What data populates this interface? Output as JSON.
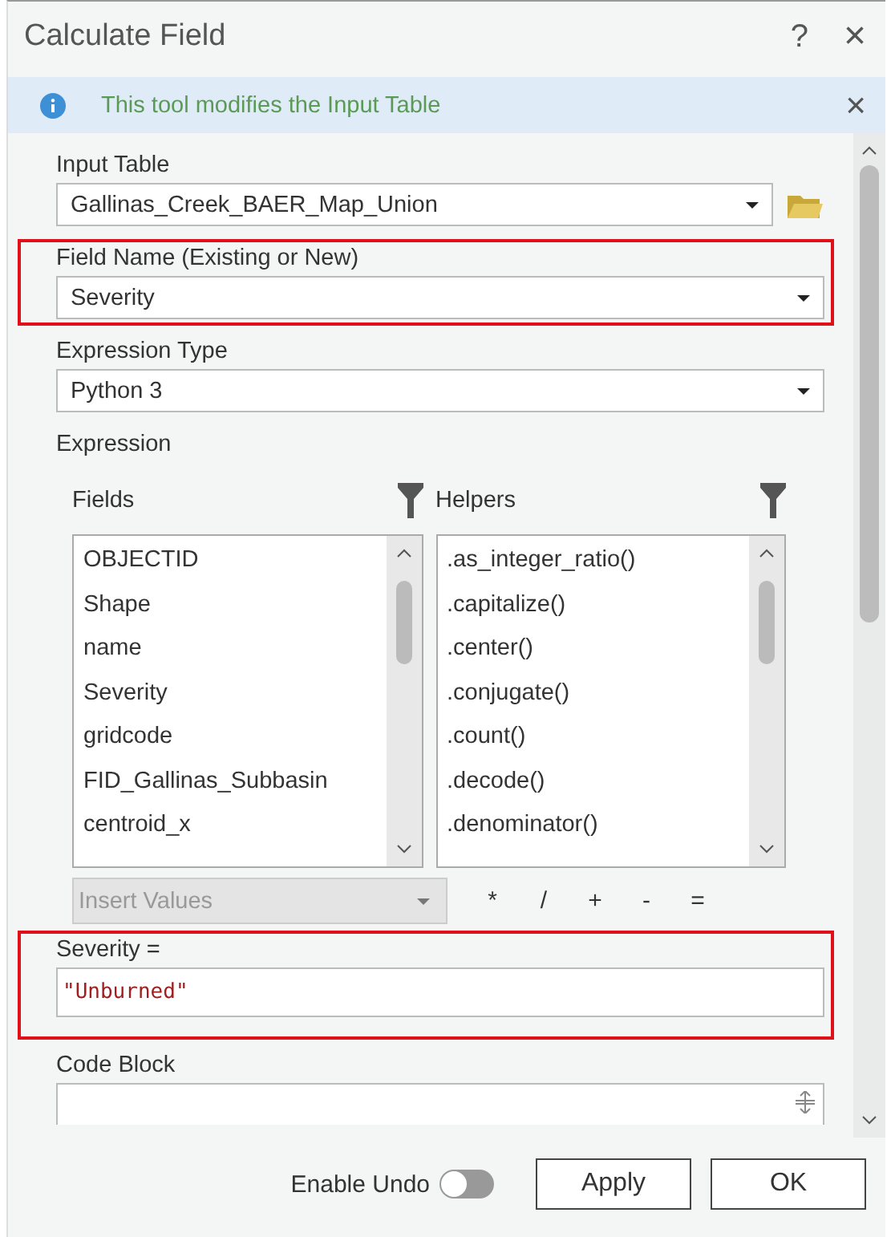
{
  "window": {
    "title": "Calculate Field",
    "help": "?",
    "close": "×"
  },
  "info_bar": {
    "message": "This tool modifies the Input Table",
    "close": "×"
  },
  "input_table": {
    "label": "Input Table",
    "value": "Gallinas_Creek_BAER_Map_Union"
  },
  "field_name": {
    "label": "Field Name (Existing or New)",
    "value": "Severity",
    "highlighted": true
  },
  "expression_type": {
    "label": "Expression Type",
    "value": "Python 3"
  },
  "expression": {
    "label": "Expression",
    "fields": {
      "label": "Fields",
      "items": [
        "OBJECTID",
        "Shape",
        "name",
        "Severity",
        "gridcode",
        "FID_Gallinas_Subbasin",
        "centroid_x"
      ]
    },
    "helpers": {
      "label": "Helpers",
      "items": [
        ".as_integer_ratio()",
        ".capitalize()",
        ".center()",
        ".conjugate()",
        ".count()",
        ".decode()",
        ".denominator()"
      ]
    },
    "insert_values": {
      "label": "Insert Values",
      "disabled": true
    },
    "operators": [
      "*",
      "/",
      "+",
      "-",
      "="
    ],
    "target_label": "Severity =",
    "value": "\"Unburned\"",
    "highlighted": true
  },
  "code_block": {
    "label": "Code Block"
  },
  "footer": {
    "enable_undo": {
      "label": "Enable Undo",
      "on": false
    },
    "buttons": [
      "Apply",
      "OK"
    ]
  }
}
